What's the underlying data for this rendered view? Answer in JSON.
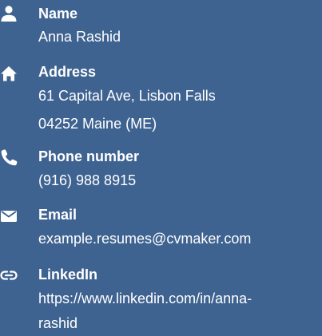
{
  "contact": {
    "name": {
      "icon": "person-icon",
      "label": "Name",
      "value_lines": [
        "Anna Rashid"
      ]
    },
    "address": {
      "icon": "home-icon",
      "label": "Address",
      "value_lines": [
        "61 Capital Ave, Lisbon Falls",
        "04252 Maine (ME)"
      ]
    },
    "phone": {
      "icon": "phone-icon",
      "label": "Phone number",
      "value_lines": [
        "(916) 988 8915"
      ]
    },
    "email": {
      "icon": "envelope-icon",
      "label": "Email",
      "value_lines": [
        "example.resumes@cvmaker.com"
      ]
    },
    "linkedin": {
      "icon": "link-icon",
      "label": "LinkedIn",
      "value_lines": [
        "https://www.linkedin.com/in/anna-",
        "rashid"
      ]
    }
  },
  "colors": {
    "background": "#3f6391",
    "text": "#ffffff"
  }
}
